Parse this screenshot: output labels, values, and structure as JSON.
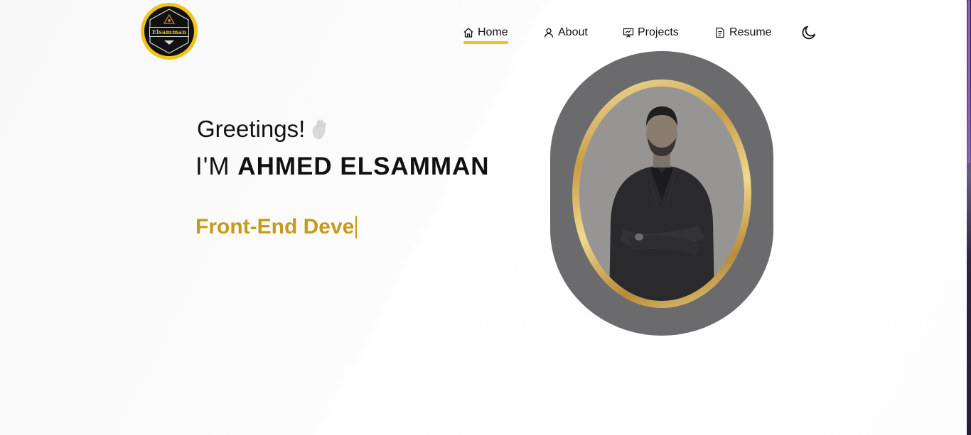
{
  "logo": {
    "text": "Elsamman"
  },
  "nav": {
    "items": [
      {
        "label": "Home",
        "icon": "home-icon",
        "active": true
      },
      {
        "label": "About",
        "icon": "user-icon",
        "active": false
      },
      {
        "label": "Projects",
        "icon": "presentation-icon",
        "active": false
      },
      {
        "label": "Resume",
        "icon": "document-icon",
        "active": false
      }
    ],
    "theme_toggle_icon": "moon-icon"
  },
  "hero": {
    "greeting": "Greetings!",
    "greeting_icon": "waving-hand-icon",
    "name_prefix": "I'M",
    "name": "AHMED ELSAMMAN",
    "typing_text": "Front-End Deve"
  },
  "colors": {
    "accent": "#f2c11a",
    "typing": "#c69a1a",
    "portrait_bg": "#6b6b6e"
  }
}
